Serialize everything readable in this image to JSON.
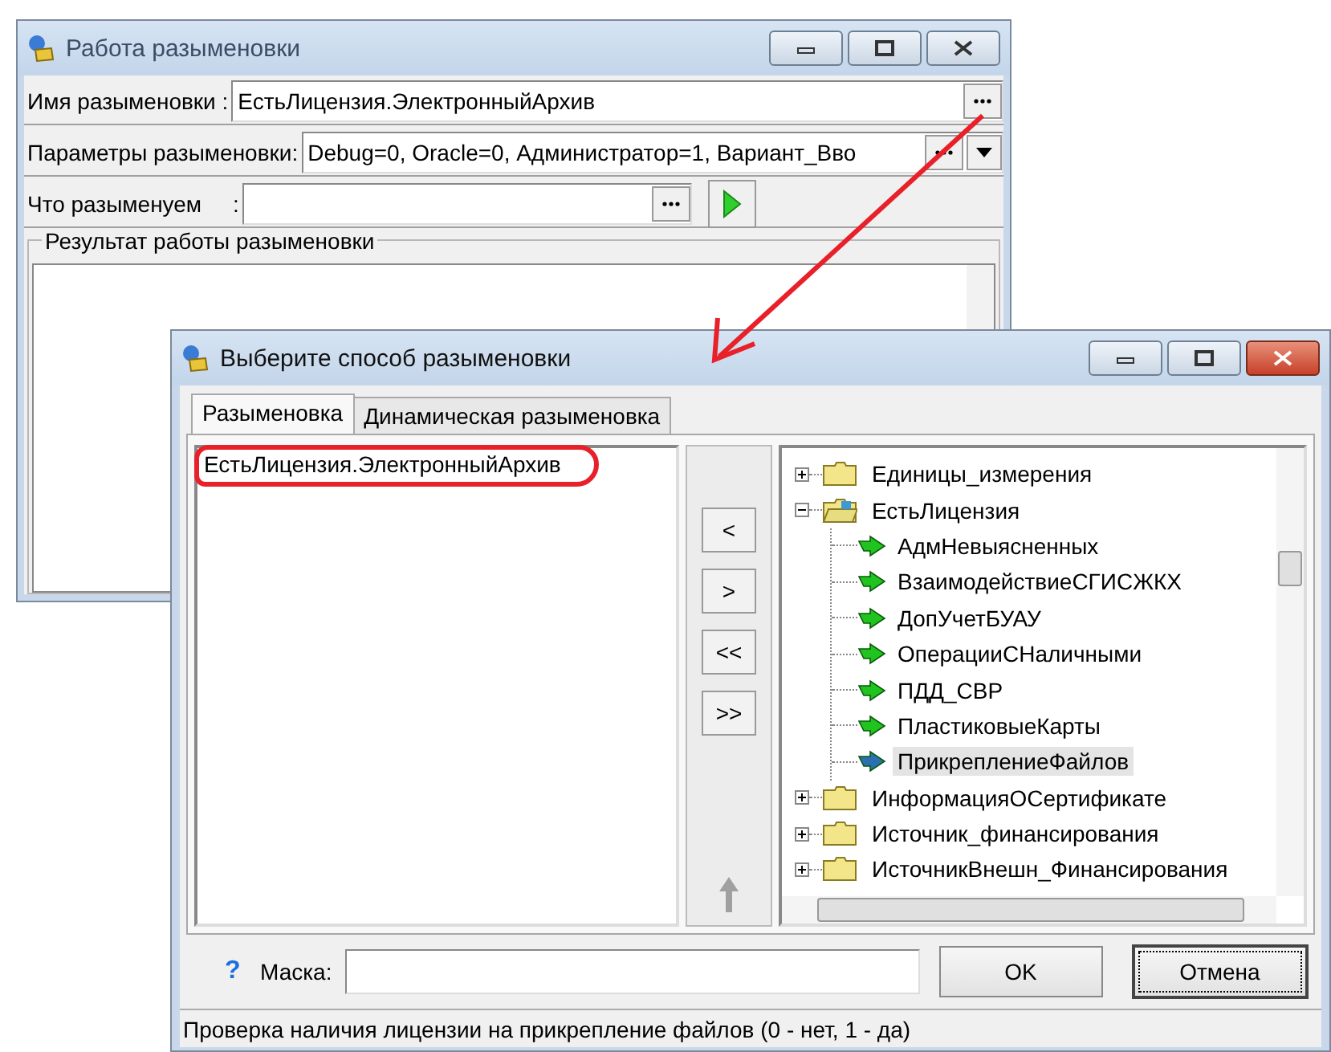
{
  "back_window": {
    "title": "Работа разыменовки",
    "fields": [
      {
        "label": "Имя разыменовки :",
        "value": "ЕстьЛицензия.ЭлектронныйАрхив",
        "kind": "browse"
      },
      {
        "label": "Параметры разыменовки:",
        "value": "Debug=0, Oracle=0, Администратор=1, Вариант_Вво",
        "kind": "combo"
      },
      {
        "label": "Что разыменуем     :",
        "kind": "run"
      }
    ],
    "result_group": {
      "title": "Результат работы разыменовки"
    }
  },
  "front_window": {
    "title": "Выберите способ разыменовки",
    "tabs": [
      {
        "label": "Разыменовка",
        "selected": true
      },
      {
        "label": "Динамическая разыменовка",
        "selected": false
      }
    ],
    "selected_list": [
      {
        "text": "ЕстьЛицензия.ЭлектронныйАрхив",
        "circled": true
      }
    ],
    "move_buttons": [
      "<",
      ">",
      "<<",
      ">>"
    ],
    "tree": [
      {
        "label": "Единицы_измерения",
        "expanded": false
      },
      {
        "label": "ЕстьЛицензия",
        "expanded": true,
        "children": [
          {
            "label": "АдмНевыясненных",
            "selected": false
          },
          {
            "label": "ВзаимодействиеСГИСЖКХ",
            "selected": false
          },
          {
            "label": "ДопУчетБУАУ",
            "selected": false
          },
          {
            "label": "ОперацииСНаличными",
            "selected": false
          },
          {
            "label": "ПДД_СВР",
            "selected": false
          },
          {
            "label": "ПластиковыеКарты",
            "selected": false
          },
          {
            "label": "ПрикреплениеФайлов",
            "selected": true
          }
        ]
      },
      {
        "label": "ИнформацияОСертификате",
        "expanded": false
      },
      {
        "label": "Источник_финансирования",
        "expanded": false
      },
      {
        "label": "ИсточникВнешн_Финансирования",
        "expanded": false
      }
    ],
    "help": "?",
    "mask_label": "Маска:",
    "buttons": [
      {
        "label": "OK",
        "focused": false
      },
      {
        "label": "Отмена",
        "focused": true
      }
    ],
    "status": "Проверка наличия лицензии на прикрепление файлов (0 - нет, 1 - да)"
  }
}
